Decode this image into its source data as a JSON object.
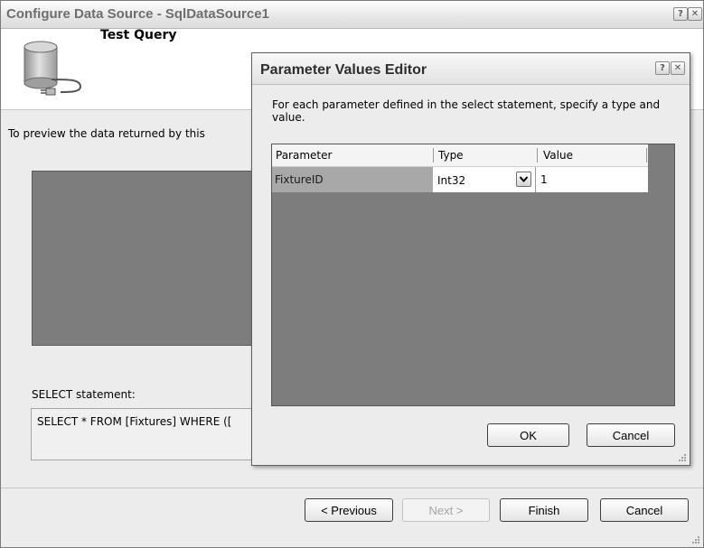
{
  "wizard": {
    "title": "Configure Data Source - SqlDataSource1",
    "help_glyph": "?",
    "close_glyph": "✕",
    "step_title": "Test Query",
    "description": "To preview the data returned by this",
    "select_label": "SELECT statement:",
    "select_text": "SELECT * FROM [Fixtures] WHERE ([",
    "buttons": {
      "previous": "< Previous",
      "next": "Next >",
      "finish": "Finish",
      "cancel": "Cancel"
    }
  },
  "dialog": {
    "title": "Parameter Values Editor",
    "help_glyph": "?",
    "close_glyph": "✕",
    "description": "For each parameter defined in the select statement, specify a type and value.",
    "columns": [
      "Parameter",
      "Type",
      "Value"
    ],
    "rows": [
      {
        "parameter": "FixtureID",
        "type": "Int32",
        "value": "1"
      }
    ],
    "buttons": {
      "ok": "OK",
      "cancel": "Cancel"
    }
  },
  "icons": {
    "header_icon": "database-plug-icon",
    "dropdown": "chevron-down-icon",
    "resize": "resize-grip-icon"
  }
}
